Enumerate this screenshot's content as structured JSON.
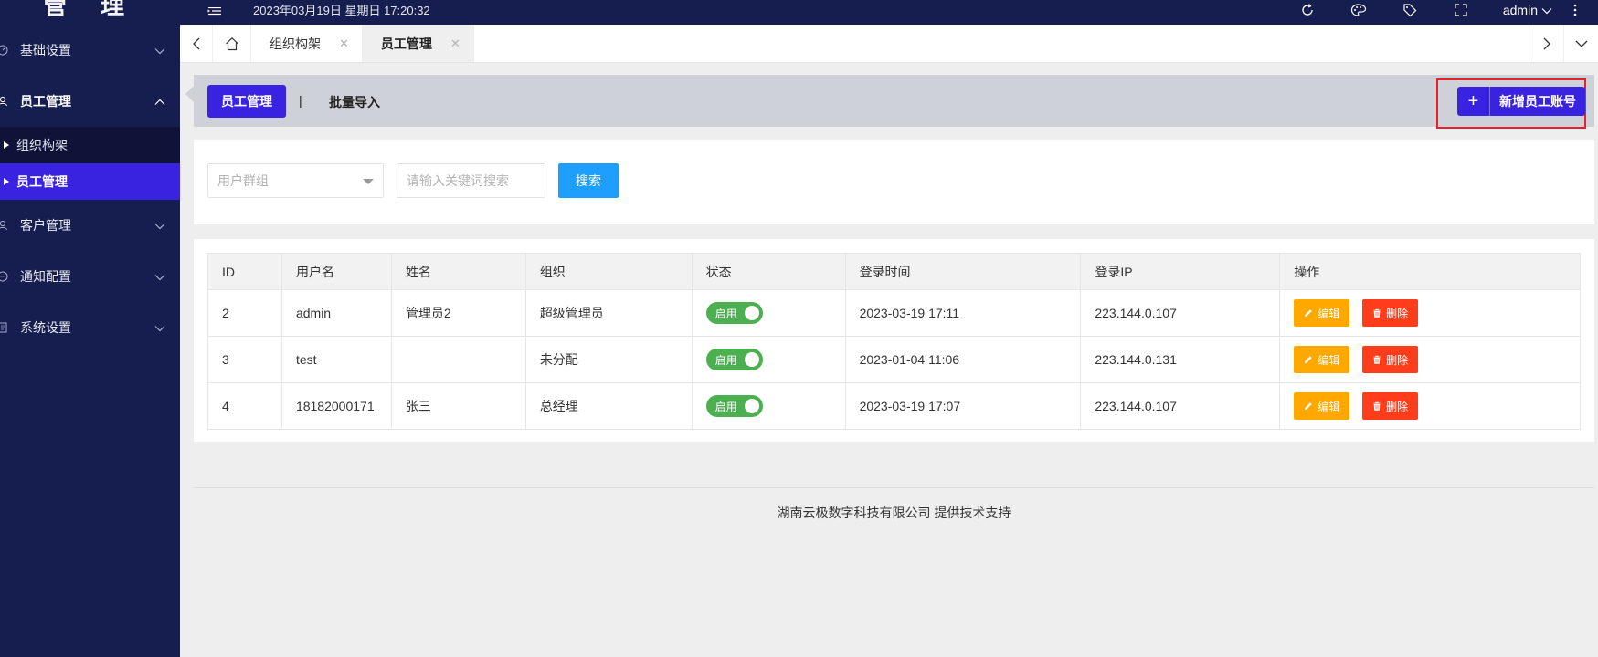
{
  "logo": {
    "text": "管 理"
  },
  "topbar": {
    "datetime": "2023年03月19日 星期日 17:20:32",
    "user": "admin"
  },
  "sidebar": {
    "items": [
      {
        "label": "基础设置",
        "icon": "dashboard-icon",
        "open": false
      },
      {
        "label": "员工管理",
        "icon": "user-group-icon",
        "open": true
      },
      {
        "label": "客户管理",
        "icon": "person-icon",
        "open": false
      },
      {
        "label": "通知配置",
        "icon": "chat-icon",
        "open": false
      },
      {
        "label": "系统设置",
        "icon": "document-icon",
        "open": false
      }
    ],
    "sub_items": [
      {
        "label": "组织构架",
        "active": false
      },
      {
        "label": "员工管理",
        "active": true
      }
    ]
  },
  "tabs": [
    {
      "label": "组织构架",
      "active": false
    },
    {
      "label": "员工管理",
      "active": true
    }
  ],
  "header": {
    "active_tab": "员工管理",
    "separator": "|",
    "second_tab": "批量导入",
    "add_button": "新增员工账号",
    "add_icon": "+"
  },
  "search": {
    "group_placeholder": "用户群组",
    "keyword_placeholder": "请输入关键词搜索",
    "button": "搜索"
  },
  "table": {
    "columns": [
      "ID",
      "用户名",
      "姓名",
      "组织",
      "状态",
      "登录时间",
      "登录IP",
      "操作"
    ],
    "rows": [
      {
        "id": "2",
        "username": "admin",
        "name": "管理员2",
        "org": "超级管理员",
        "status": "启用",
        "login_time": "2023-03-19 17:11",
        "login_ip": "223.144.0.107"
      },
      {
        "id": "3",
        "username": "test",
        "name": "",
        "org": "未分配",
        "status": "启用",
        "login_time": "2023-01-04 11:06",
        "login_ip": "223.144.0.131"
      },
      {
        "id": "4",
        "username": "18182000171",
        "name": "张三",
        "org": "总经理",
        "status": "启用",
        "login_time": "2023-03-19 17:07",
        "login_ip": "223.144.0.107"
      }
    ],
    "edit_label": "编辑",
    "delete_label": "删除"
  },
  "footer": {
    "text": "湖南云极数字科技有限公司 提供技术支持"
  },
  "colors": {
    "sidebar_bg": "#161d4f",
    "accent": "#3a23e0",
    "search_button": "#1e9fff",
    "switch_on": "#4caf50",
    "edit": "#ffa800",
    "delete": "#ff3d1a",
    "highlight_outline": "#e8202a"
  }
}
